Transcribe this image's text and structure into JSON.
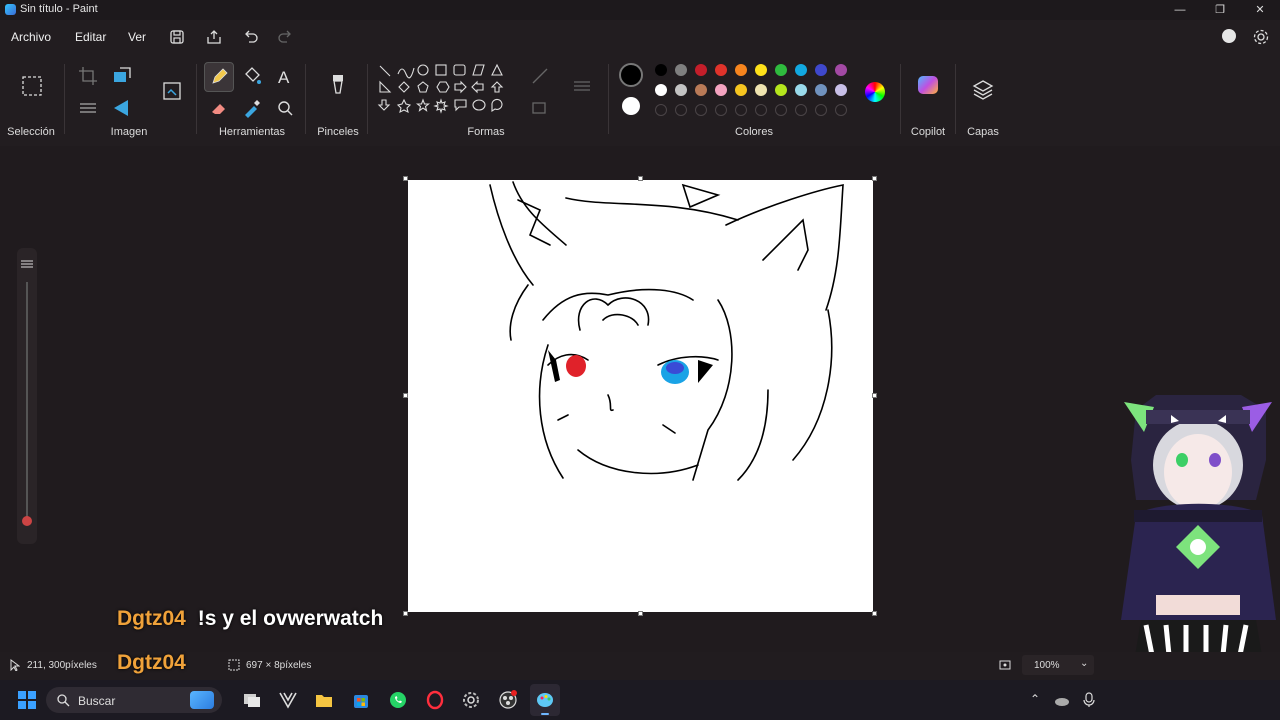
{
  "window": {
    "title": "Sin título - Paint"
  },
  "menu": {
    "archivo": "Archivo",
    "editar": "Editar",
    "ver": "Ver"
  },
  "ribbon": {
    "groups": {
      "seleccion": "Selección",
      "imagen": "Imagen",
      "herramientas": "Herramientas",
      "pinceles": "Pinceles",
      "formas": "Formas",
      "colores": "Colores",
      "copilot": "Copilot",
      "capas": "Capas"
    }
  },
  "colors": {
    "primary": "#000000",
    "secondary": "#ffffff",
    "row1": [
      "#000000",
      "#7f7f7f",
      "#c41e2a",
      "#e0332b",
      "#f7851e",
      "#ffe11a",
      "#2fbb3e",
      "#12a8e0",
      "#3f48cc",
      "#a349a4"
    ],
    "row2": [
      "#ffffff",
      "#c3c3c3",
      "#b97a57",
      "#f4a3c0",
      "#f6c520",
      "#efe4b0",
      "#b5e61d",
      "#99d9ea",
      "#7092be",
      "#c8bfe7"
    ]
  },
  "status": {
    "cursor": "211, 300píxeles",
    "size": "697 × 8píxeles",
    "zoom": "100%"
  },
  "chat": [
    {
      "user": "Dgtz04",
      "message": "!s y el ovwerwatch"
    },
    {
      "user": "Dgtz04",
      "message": ""
    }
  ],
  "taskbar": {
    "search_placeholder": "Buscar"
  }
}
